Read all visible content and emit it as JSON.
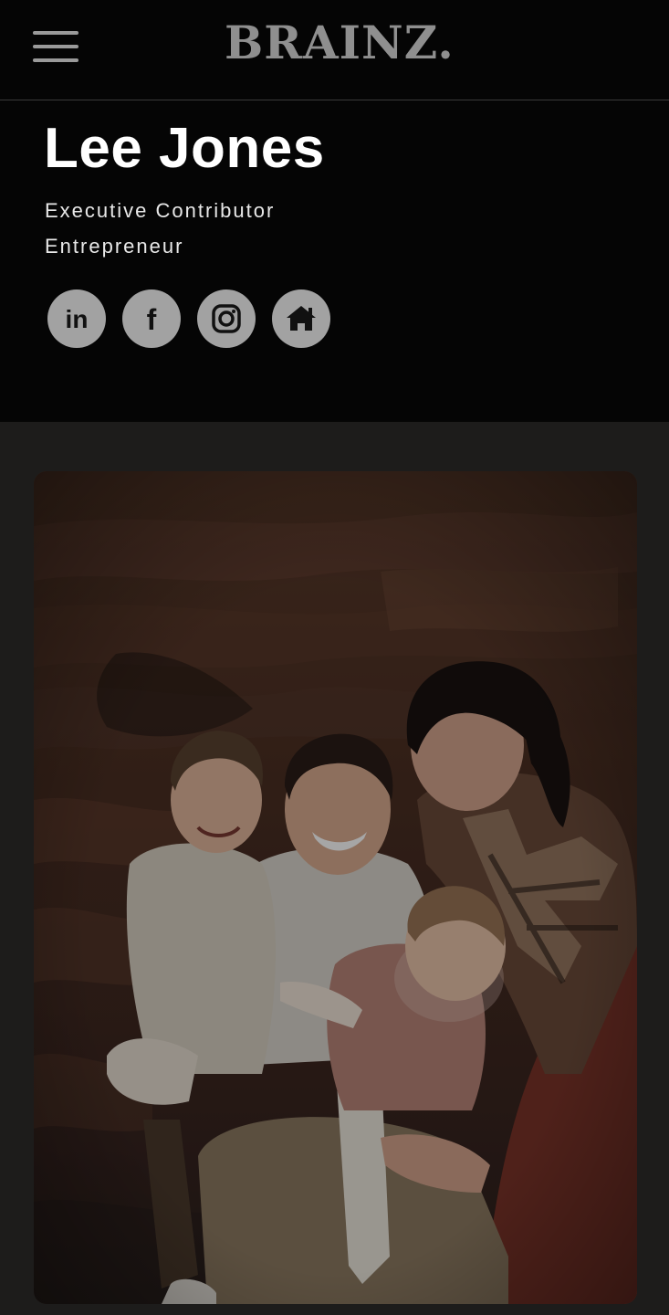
{
  "header": {
    "brand": "BRAINZ.",
    "menu_icon": "hamburger-menu-icon"
  },
  "profile": {
    "name": "Lee Jones",
    "roles": [
      "Executive Contributor",
      "Entrepreneur"
    ],
    "socials": [
      {
        "icon": "linkedin-icon",
        "glyph": "in"
      },
      {
        "icon": "facebook-icon",
        "glyph": "f"
      },
      {
        "icon": "instagram-icon"
      },
      {
        "icon": "home-icon"
      }
    ]
  },
  "colors": {
    "page_bg": "#050505",
    "content_bg": "#1d1c1b",
    "brand": "#8f8f8f",
    "social_bg": "#a2a2a2",
    "text": "#ffffff"
  }
}
